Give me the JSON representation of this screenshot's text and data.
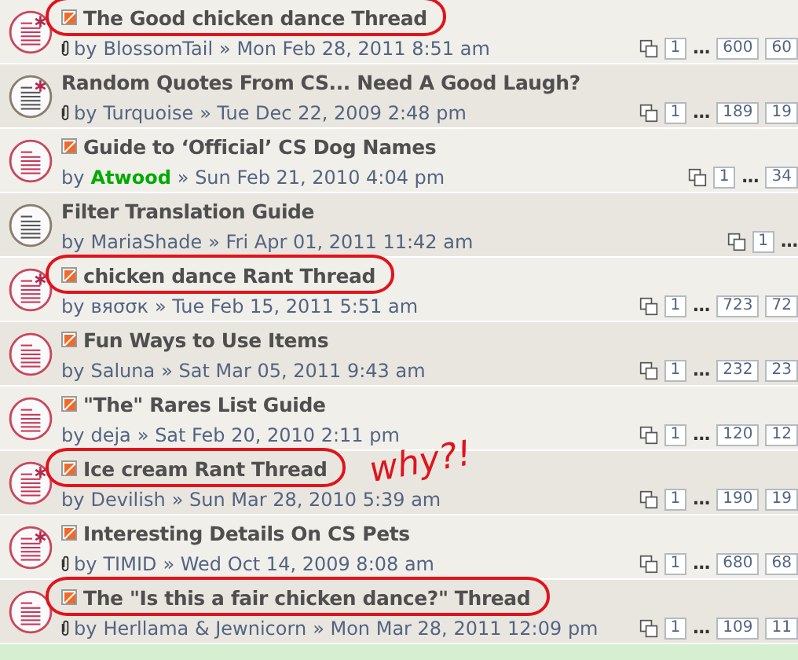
{
  "rows": [
    {
      "title": "The Good chicken dance Thread",
      "by": "by",
      "author": "BlossomTail",
      "date": "» Mon Feb 28, 2011 8:51 am",
      "unread": true,
      "starred": true,
      "new_post": true,
      "attachment": true,
      "circled": true,
      "pages": [
        "1",
        "…",
        "600",
        "60"
      ]
    },
    {
      "title": "Random Quotes From CS... Need A Good Laugh?",
      "by": "by",
      "author": "Turquoise",
      "date": "» Tue Dec 22, 2009 2:48 pm",
      "unread": false,
      "starred": true,
      "new_post": false,
      "attachment": true,
      "circled": false,
      "pages": [
        "1",
        "…",
        "189",
        "19"
      ]
    },
    {
      "title": "Guide to ‘Official’ CS Dog Names",
      "by": "by",
      "author": "Atwood",
      "color": "#00aa00",
      "date": "» Sun Feb 21, 2010 4:04 pm",
      "unread": true,
      "starred": false,
      "new_post": true,
      "attachment": false,
      "circled": false,
      "pages": [
        "1",
        "…",
        "34"
      ]
    },
    {
      "title": "Filter Translation Guide",
      "by": "by",
      "author": "MariaShade",
      "date": "» Fri Apr 01, 2011 11:42 am",
      "unread": false,
      "starred": false,
      "new_post": false,
      "attachment": false,
      "circled": false,
      "pages": [
        "1",
        "…"
      ]
    },
    {
      "title": "chicken dance Rant Thread",
      "by": "by",
      "author": "вяσσк",
      "date": "» Tue Feb 15, 2011 5:51 am",
      "unread": true,
      "starred": true,
      "new_post": true,
      "attachment": false,
      "circled": true,
      "pages": [
        "1",
        "…",
        "723",
        "72"
      ]
    },
    {
      "title": "Fun Ways to Use Items",
      "by": "by",
      "author": "Saluna",
      "date": "» Sat Mar 05, 2011 9:43 am",
      "unread": true,
      "starred": false,
      "new_post": true,
      "attachment": false,
      "circled": false,
      "pages": [
        "1",
        "…",
        "232",
        "23"
      ]
    },
    {
      "title": "\"The\" Rares List Guide",
      "by": "by",
      "author": "deja",
      "date": "» Sat Feb 20, 2010 2:11 pm",
      "unread": true,
      "starred": false,
      "new_post": true,
      "attachment": false,
      "circled": false,
      "pages": [
        "1",
        "…",
        "120",
        "12"
      ]
    },
    {
      "title": "Ice cream Rant Thread",
      "by": "by",
      "author": "Devilish",
      "date": "» Sun Mar 28, 2010 5:39 am",
      "unread": true,
      "starred": true,
      "new_post": true,
      "attachment": false,
      "circled": true,
      "note": "why?!",
      "pages": [
        "1",
        "…",
        "190",
        "19"
      ]
    },
    {
      "title": "Interesting Details On CS Pets",
      "by": "by",
      "author": "TIMID",
      "date": "» Wed Oct 14, 2009 8:08 am",
      "unread": true,
      "starred": true,
      "new_post": true,
      "attachment": true,
      "circled": false,
      "pages": [
        "1",
        "…",
        "680",
        "68"
      ]
    },
    {
      "title": "The \"Is this a fair chicken dance?\" Thread",
      "by": "by",
      "author": "Herllama & Jewnicorn",
      "date": "» Mon Mar 28, 2011 12:09 pm",
      "unread": true,
      "starred": false,
      "new_post": true,
      "attachment": true,
      "circled": true,
      "pages": [
        "1",
        "…",
        "109",
        "11"
      ]
    }
  ]
}
